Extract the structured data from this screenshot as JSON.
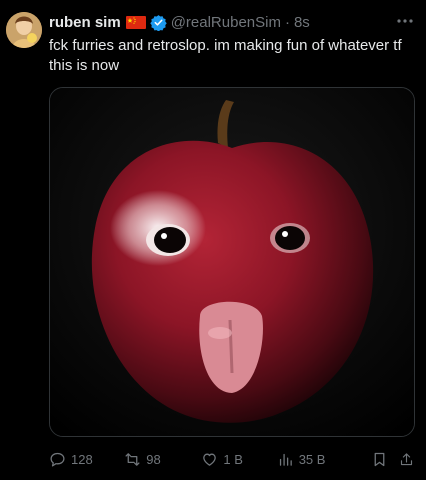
{
  "author": {
    "name": "ruben sim",
    "handle": "@realRubenSim",
    "separator": "·",
    "time": "8s",
    "flag_icon": "china-flag-icon",
    "verified_icon": "verified-badge-icon"
  },
  "tweet": {
    "text": "fck furries and retroslop. im making fun of whatever tf this is now"
  },
  "actions": {
    "replies": "128",
    "reposts": "98",
    "likes": "1 B",
    "views": "35 B"
  },
  "colors": {
    "background": "#000000",
    "text": "#e7e9ea",
    "secondary": "#71767b",
    "verified": "#1d9bf0",
    "flag_red": "#de2910",
    "flag_yellow": "#ffde00"
  }
}
